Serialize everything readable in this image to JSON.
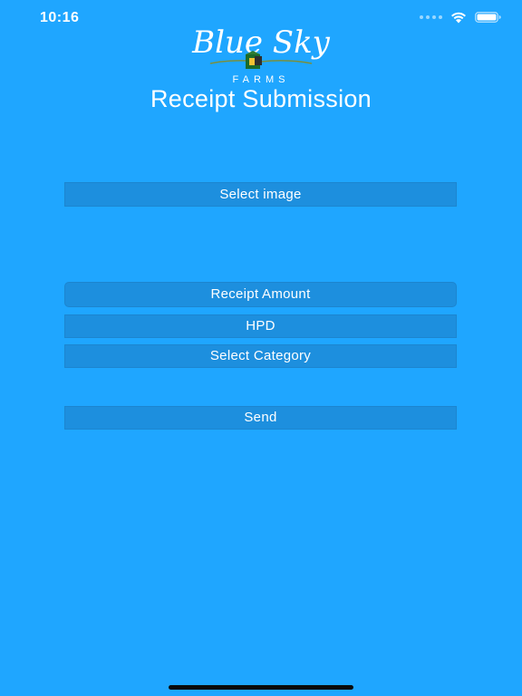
{
  "status_bar": {
    "time": "10:16"
  },
  "logo": {
    "script_text": "Blue Sky",
    "sub_text": "FARMS"
  },
  "page_title": "Receipt Submission",
  "buttons": {
    "select_image": "Select image",
    "receipt_amount": "Receipt Amount",
    "hpd": "HPD",
    "select_category": "Select Category",
    "send": "Send"
  },
  "colors": {
    "background": "#1fa6ff",
    "button": "#1d8fde",
    "text": "#ffffff"
  }
}
